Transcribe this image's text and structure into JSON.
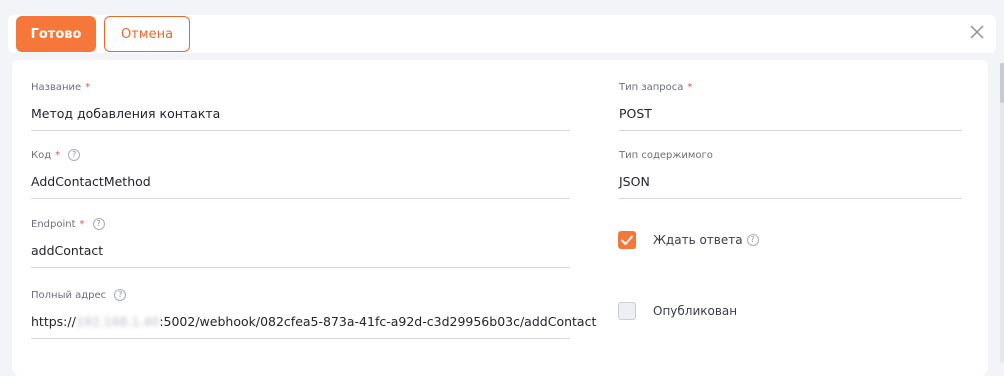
{
  "toolbar": {
    "done_label": "Готово",
    "cancel_label": "Отмена"
  },
  "form": {
    "name": {
      "label": "Название",
      "required": "*",
      "value": "Метод добавления контакта"
    },
    "code": {
      "label": "Код",
      "required": "*",
      "value": "AddContactMethod"
    },
    "endpoint": {
      "label": "Endpoint",
      "required": "*",
      "value": "addContact"
    },
    "full_address": {
      "label": "Полный адрес",
      "prefix": "https://",
      "host": "192.168.1.40",
      "suffix": ":5002/webhook/082cfea5-873a-41fc-a92d-c3d29956b03c/addContact"
    },
    "request_type": {
      "label": "Тип запроса",
      "required": "*",
      "value": "POST"
    },
    "content_type": {
      "label": "Тип содержимого",
      "value": "JSON"
    },
    "wait_response": {
      "label": "Ждать ответа",
      "checked": true
    },
    "published": {
      "label": "Опубликован",
      "checked": false
    }
  },
  "icons": {
    "close": "close-icon",
    "help": "help-icon",
    "check": "check-icon"
  },
  "colors": {
    "accent": "#f5783a",
    "required": "#e5533c"
  },
  "help_glyph": "?"
}
